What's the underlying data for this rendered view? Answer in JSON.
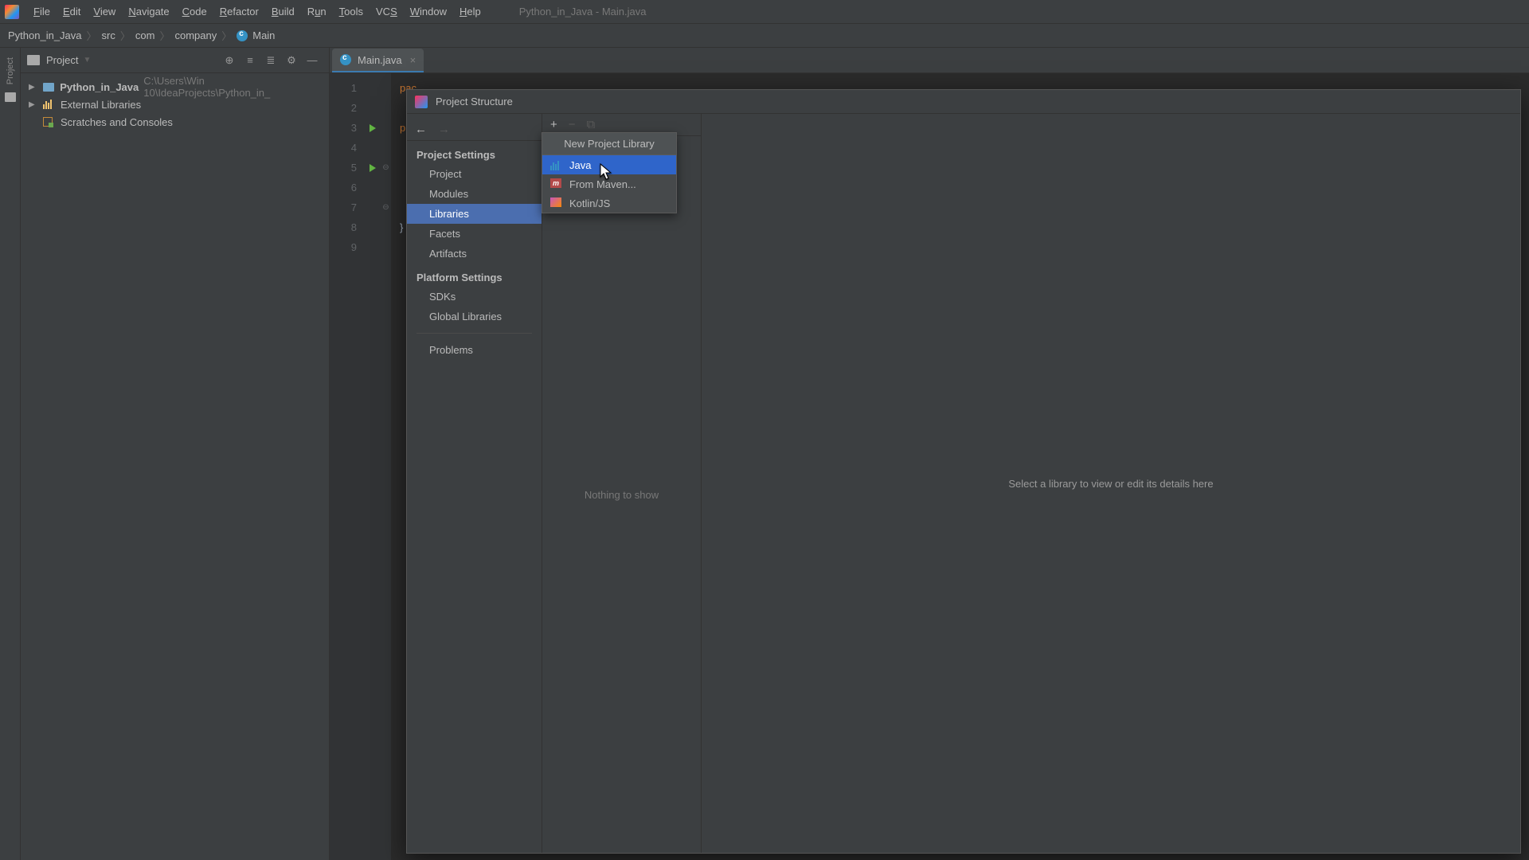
{
  "menu": {
    "items": [
      "File",
      "Edit",
      "View",
      "Navigate",
      "Code",
      "Refactor",
      "Build",
      "Run",
      "Tools",
      "VCS",
      "Window",
      "Help"
    ],
    "title": "Python_in_Java - Main.java"
  },
  "breadcrumb": {
    "items": [
      "Python_in_Java",
      "src",
      "com",
      "company",
      "Main"
    ]
  },
  "projectPanel": {
    "header": {
      "label": "Project"
    },
    "tree": {
      "root": {
        "name": "Python_in_Java",
        "path": "C:\\Users\\Win 10\\IdeaProjects\\Python_in_"
      },
      "external": "External Libraries",
      "scratches": "Scratches and Consoles"
    }
  },
  "tab": {
    "label": "Main.java"
  },
  "editor": {
    "lines": [
      "pac",
      "",
      "pub",
      "",
      "",
      "",
      "",
      "}",
      ""
    ],
    "lineCount": 9,
    "runLines": [
      3,
      5
    ],
    "foldLines": {
      "5": "⊖",
      "7": "⊖"
    }
  },
  "dialog": {
    "title": "Project Structure",
    "nav": {
      "projectSettingsHeading": "Project Settings",
      "projectSettings": [
        "Project",
        "Modules",
        "Libraries",
        "Facets",
        "Artifacts"
      ],
      "selected": "Libraries",
      "platformHeading": "Platform Settings",
      "platform": [
        "SDKs",
        "Global Libraries"
      ],
      "problems": "Problems"
    },
    "mid": {
      "empty": "Nothing to show"
    },
    "right": "Select a library to view or edit its details here"
  },
  "popup": {
    "title": "New Project Library",
    "items": [
      {
        "label": "Java",
        "icon": "bars",
        "selected": true
      },
      {
        "label": "From Maven...",
        "icon": "m"
      },
      {
        "label": "Kotlin/JS",
        "icon": "k"
      }
    ]
  }
}
